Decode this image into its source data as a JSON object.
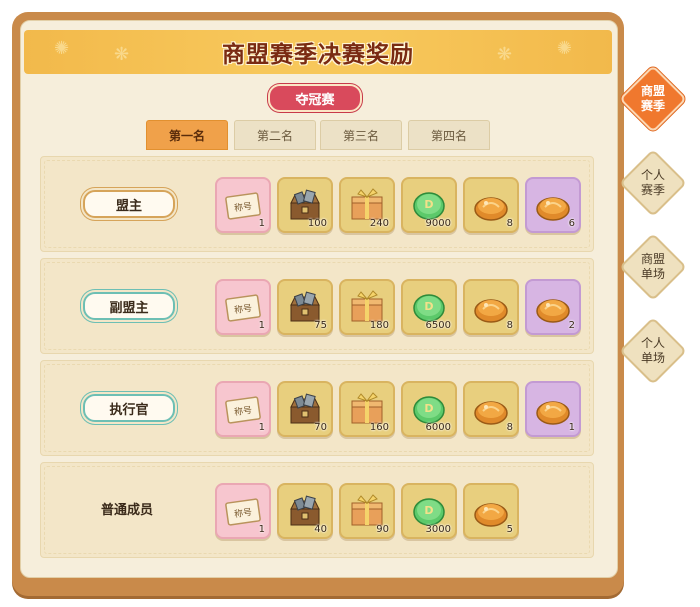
{
  "header": {
    "title": "商盟赛季决赛奖励",
    "subtitle_tag": "夺冠赛"
  },
  "tabs": [
    {
      "label": "第一名",
      "active": true
    },
    {
      "label": "第二名",
      "active": false
    },
    {
      "label": "第三名",
      "active": false
    },
    {
      "label": "第四名",
      "active": false
    }
  ],
  "rows": [
    {
      "role": "盟主",
      "style": "gold",
      "items": [
        {
          "icon": "title-card-icon",
          "bg": "pink",
          "qty": "1"
        },
        {
          "icon": "chest-icon",
          "bg": "gold",
          "qty": "100"
        },
        {
          "icon": "gift-box-icon",
          "bg": "gold",
          "qty": "240"
        },
        {
          "icon": "jade-coin-icon",
          "bg": "gold",
          "qty": "9000"
        },
        {
          "icon": "amber-gem-icon",
          "bg": "gold",
          "qty": "8"
        },
        {
          "icon": "amber-gem-icon",
          "bg": "lilac",
          "qty": "6"
        }
      ]
    },
    {
      "role": "副盟主",
      "style": "teal",
      "items": [
        {
          "icon": "title-card-icon",
          "bg": "pink",
          "qty": "1"
        },
        {
          "icon": "chest-icon",
          "bg": "gold",
          "qty": "75"
        },
        {
          "icon": "gift-box-icon",
          "bg": "gold",
          "qty": "180"
        },
        {
          "icon": "jade-coin-icon",
          "bg": "gold",
          "qty": "6500"
        },
        {
          "icon": "amber-gem-icon",
          "bg": "gold",
          "qty": "8"
        },
        {
          "icon": "amber-gem-icon",
          "bg": "lilac",
          "qty": "2"
        }
      ]
    },
    {
      "role": "执行官",
      "style": "teal",
      "items": [
        {
          "icon": "title-card-icon",
          "bg": "pink",
          "qty": "1"
        },
        {
          "icon": "chest-icon",
          "bg": "gold",
          "qty": "70"
        },
        {
          "icon": "gift-box-icon",
          "bg": "gold",
          "qty": "160"
        },
        {
          "icon": "jade-coin-icon",
          "bg": "gold",
          "qty": "6000"
        },
        {
          "icon": "amber-gem-icon",
          "bg": "gold",
          "qty": "8"
        },
        {
          "icon": "amber-gem-icon",
          "bg": "lilac",
          "qty": "1"
        }
      ]
    },
    {
      "role": "普通成员",
      "style": "plain",
      "items": [
        {
          "icon": "title-card-icon",
          "bg": "pink",
          "qty": "1"
        },
        {
          "icon": "chest-icon",
          "bg": "gold",
          "qty": "40"
        },
        {
          "icon": "gift-box-icon",
          "bg": "gold",
          "qty": "90"
        },
        {
          "icon": "jade-coin-icon",
          "bg": "gold",
          "qty": "3000"
        },
        {
          "icon": "amber-gem-icon",
          "bg": "gold",
          "qty": "5"
        }
      ]
    }
  ],
  "side_tabs": [
    {
      "label": "商盟赛季",
      "active": true
    },
    {
      "label": "个人赛季",
      "active": false
    },
    {
      "label": "商盟单场",
      "active": false
    },
    {
      "label": "个人单场",
      "active": false
    }
  ],
  "card_text": "称号",
  "colors": {
    "accent": "#f0782e",
    "tab_active": "#f0a14a",
    "banner": "#f7c75a",
    "tag": "#d94a5c"
  }
}
